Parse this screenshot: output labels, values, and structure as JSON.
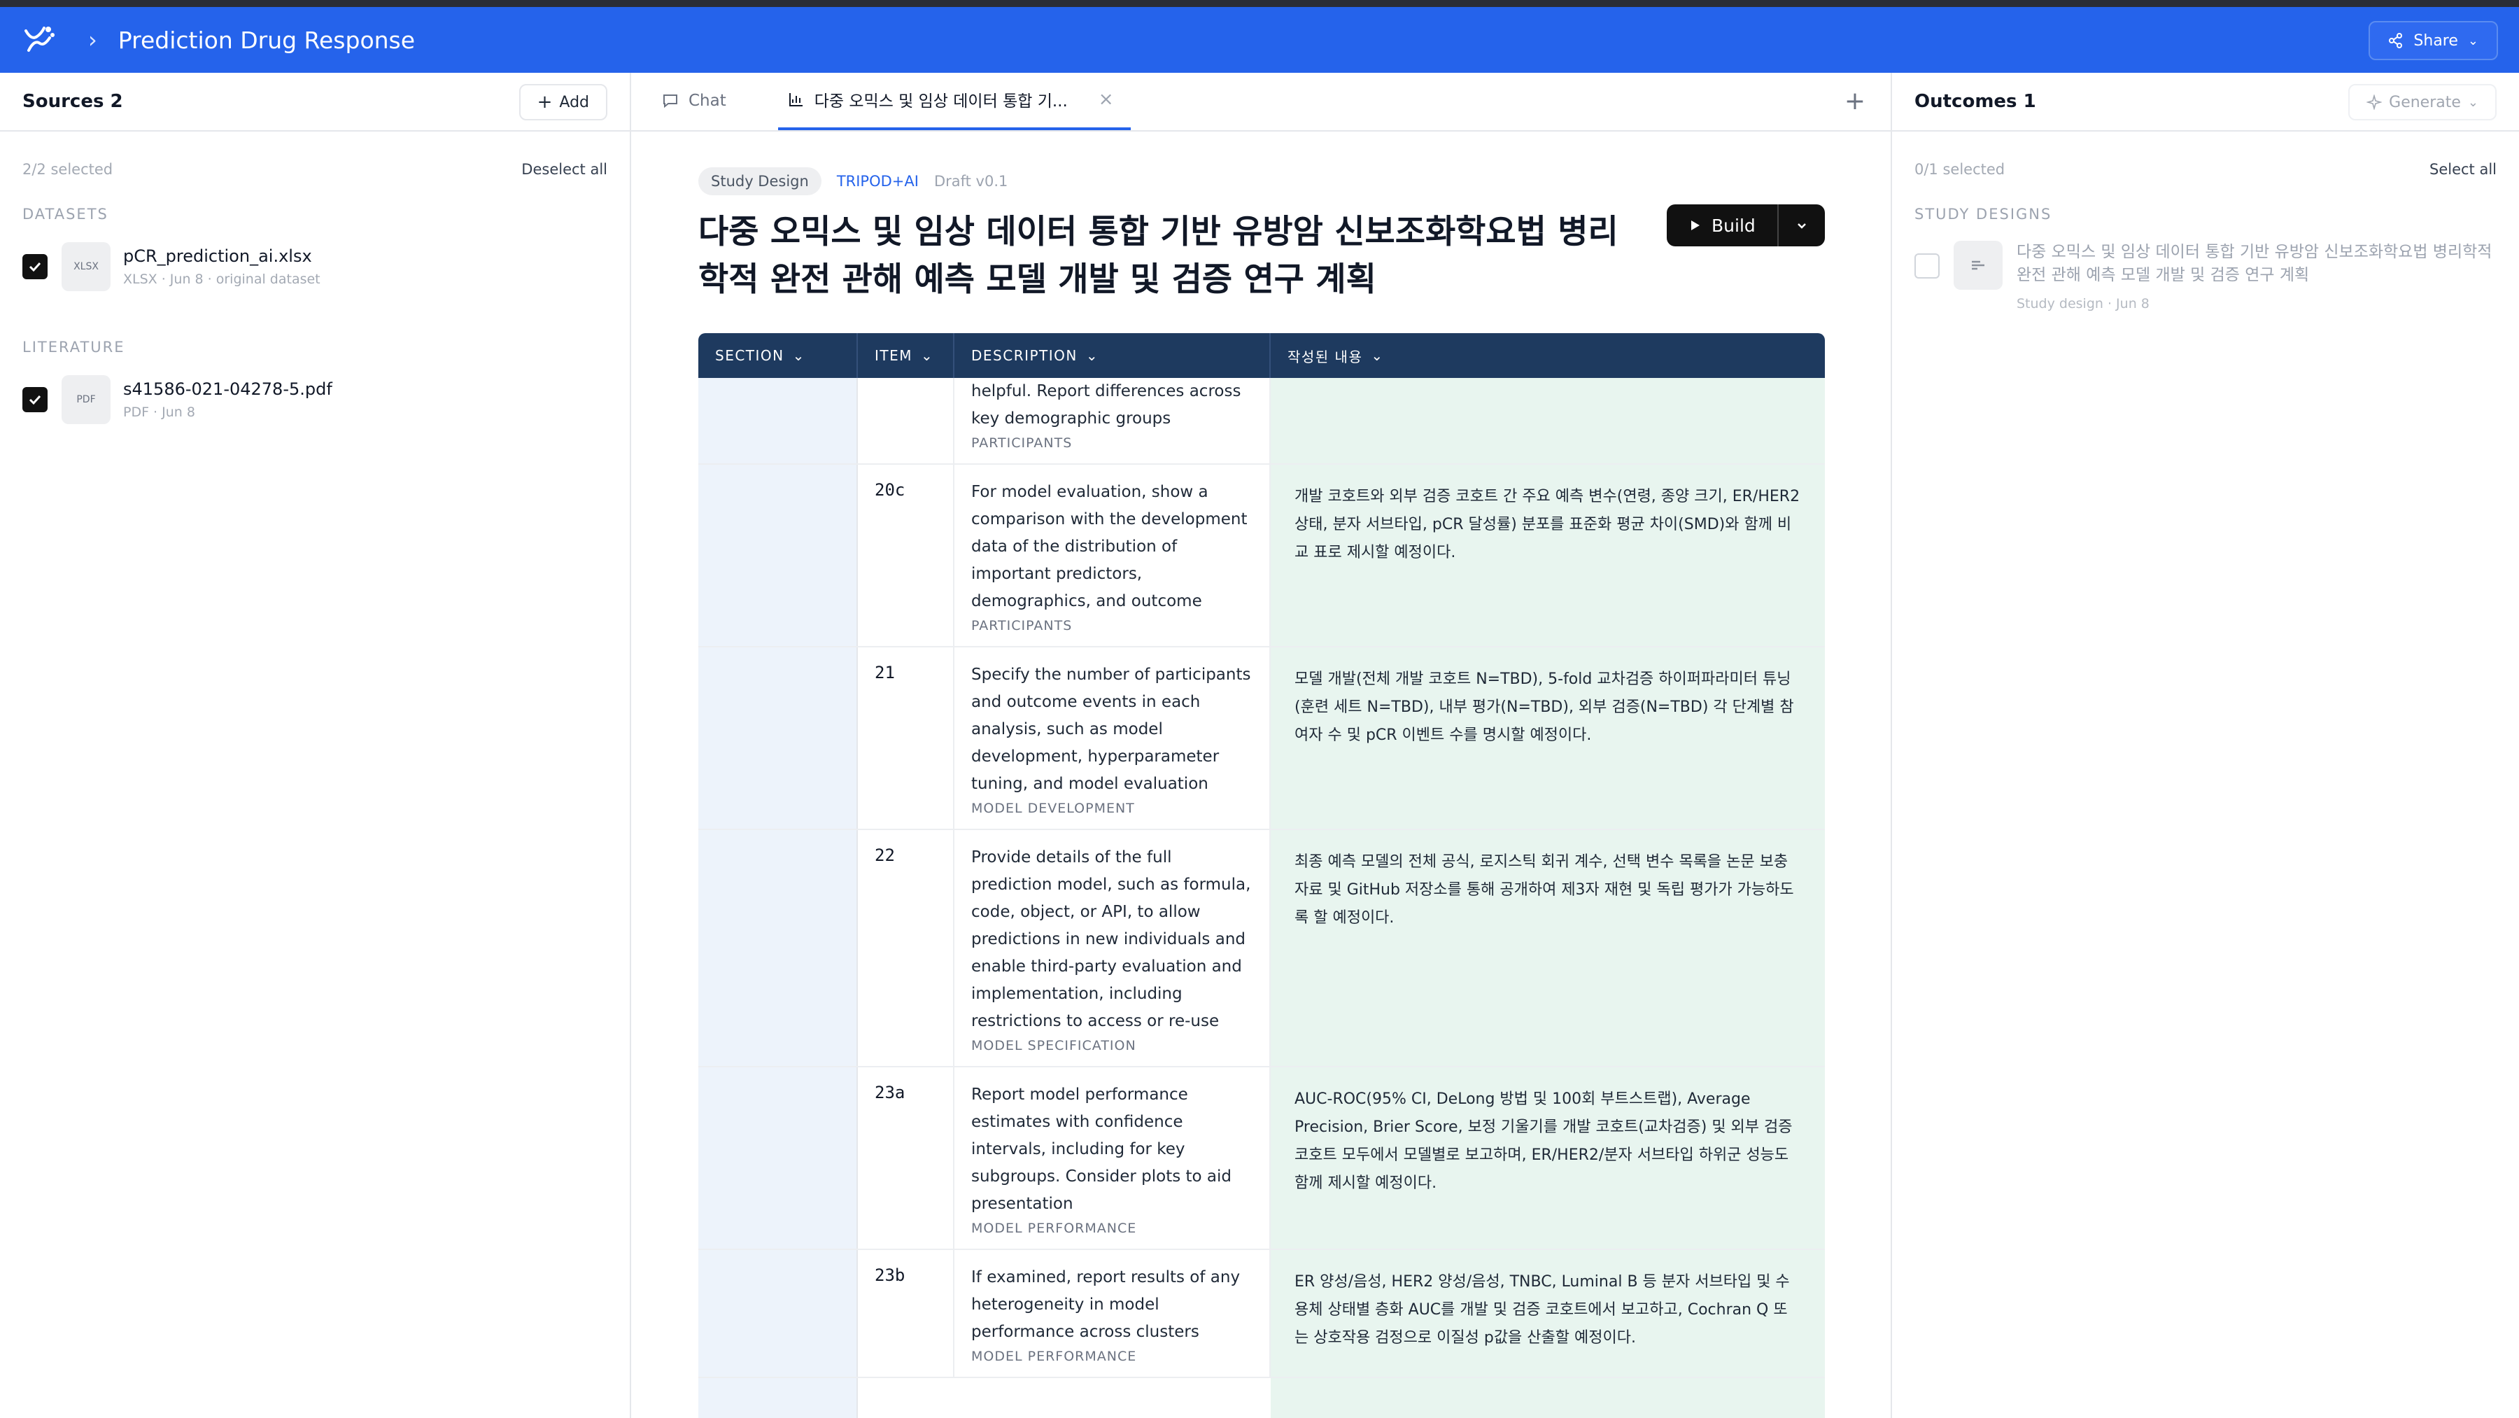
{
  "app": {
    "title": "Prediction Drug Response",
    "share_label": "Share"
  },
  "sources": {
    "title": "Sources 2",
    "add_label": "Add",
    "selected_text": "2/2 selected",
    "deselect_label": "Deselect all",
    "groups": [
      {
        "label": "DATASETS",
        "items": [
          {
            "type": "XLSX",
            "name": "pCR_prediction_ai.xlsx",
            "meta": "XLSX · Jun 8 · original dataset",
            "checked": true
          }
        ]
      },
      {
        "label": "LITERATURE",
        "items": [
          {
            "type": "PDF",
            "name": "s41586-021-04278-5.pdf",
            "meta": "PDF · Jun 8",
            "checked": true
          }
        ]
      }
    ]
  },
  "tabs": [
    {
      "label": "Chat",
      "icon": "chat-icon"
    },
    {
      "label": "다중 오믹스 및 임상 데이터 통합 기...",
      "icon": "chart-icon",
      "active": true
    }
  ],
  "doc": {
    "chip_type": "Study Design",
    "chip_guideline": "TRIPOD+AI",
    "chip_version": "Draft v0.1",
    "title": "다중 오믹스 및 임상 데이터 통합 기반 유방암 신보조화학요법 병리학적 완전 관해 예측 모델 개발 및 검증 연구 계획",
    "build_label": "Build"
  },
  "table": {
    "headers": [
      "SECTION",
      "ITEM",
      "DESCRIPTION",
      "작성된 내용"
    ],
    "rows": [
      {
        "item": "",
        "description": "helpful. Report differences across key demographic groups",
        "category": "PARTICIPANTS",
        "content": ""
      },
      {
        "item": "20c",
        "description": "For model evaluation, show a comparison with the development data of the distribution of important predictors, demographics, and outcome",
        "category": "PARTICIPANTS",
        "content": "개발 코호트와 외부 검증 코호트 간 주요 예측 변수(연령, 종양 크기, ER/HER2 상태, 분자 서브타입, pCR 달성률) 분포를 표준화 평균 차이(SMD)와 함께 비교 표로 제시할 예정이다."
      },
      {
        "item": "21",
        "description": "Specify the number of participants and outcome events in each analysis, such as model development, hyperparameter tuning, and model evaluation",
        "category": "MODEL DEVELOPMENT",
        "content": "모델 개발(전체 개발 코호트 N=TBD), 5-fold 교차검증 하이퍼파라미터 튜닝(훈련 세트 N=TBD), 내부 평가(N=TBD), 외부 검증(N=TBD) 각 단계별 참여자 수 및 pCR 이벤트 수를 명시할 예정이다."
      },
      {
        "item": "22",
        "description": "Provide details of the full prediction model, such as formula, code, object, or API, to allow predictions in new individuals and enable third-party evaluation and implementation, including restrictions to access or re-use",
        "category": "MODEL SPECIFICATION",
        "content": "최종 예측 모델의 전체 공식, 로지스틱 회귀 계수, 선택 변수 목록을 논문 보충 자료 및 GitHub 저장소를 통해 공개하여 제3자 재현 및 독립 평가가 가능하도록 할 예정이다."
      },
      {
        "item": "23a",
        "description": "Report model performance estimates with confidence intervals, including for key subgroups. Consider plots to aid presentation",
        "category": "MODEL PERFORMANCE",
        "content": "AUC-ROC(95% CI, DeLong 방법 및 100회 부트스트랩), Average Precision, Brier Score, 보정 기울기를 개발 코호트(교차검증) 및 외부 검증 코호트 모두에서 모델별로 보고하며, ER/HER2/분자 서브타입 하위군 성능도 함께 제시할 예정이다."
      },
      {
        "item": "23b",
        "description": "If examined, report results of any heterogeneity in model performance across clusters",
        "category": "MODEL PERFORMANCE",
        "content": "ER 양성/음성, HER2 양성/음성, TNBC, Luminal B 등 분자 서브타입 및 수용체 상태별 층화 AUC를 개발 및 검증 코호트에서 보고하고, Cochran Q 또는 상호작용 검정으로 이질성 p값을 산출할 예정이다."
      }
    ]
  },
  "outcomes": {
    "title": "Outcomes 1",
    "generate_label": "Generate",
    "selected_text": "0/1 selected",
    "select_all_label": "Select all",
    "group_label": "STUDY DESIGNS",
    "items": [
      {
        "title": "다중 오믹스 및 임상 데이터 통합 기반 유방암 신보조화학요법 병리학적 완전 관해 예측 모델 개발 및 검증 연구 계획",
        "meta": "Study design · Jun 8",
        "checked": false
      }
    ]
  }
}
